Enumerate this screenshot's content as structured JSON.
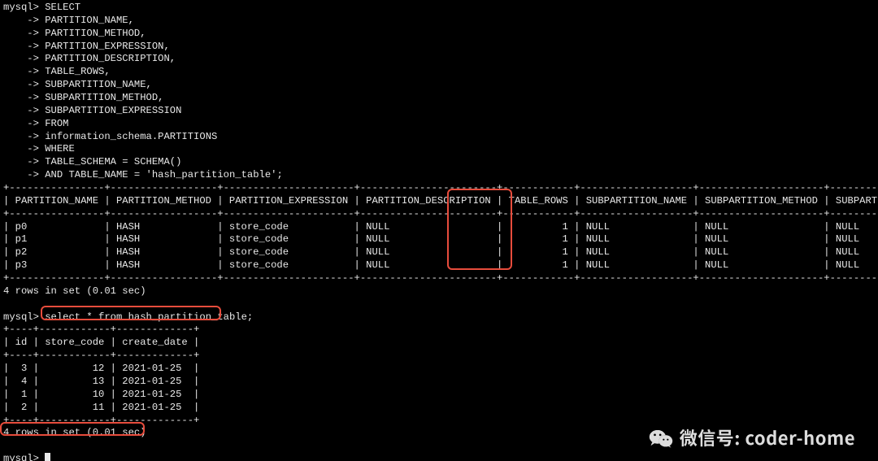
{
  "prompt_main": "mysql>",
  "prompt_cont": "    ->",
  "query1": {
    "lines": [
      "SELECT",
      "PARTITION_NAME,",
      "PARTITION_METHOD,",
      "PARTITION_EXPRESSION,",
      "PARTITION_DESCRIPTION,",
      "TABLE_ROWS,",
      "SUBPARTITION_NAME,",
      "SUBPARTITION_METHOD,",
      "SUBPARTITION_EXPRESSION",
      "FROM",
      "information_schema.PARTITIONS",
      "WHERE",
      "TABLE_SCHEMA = SCHEMA()",
      "AND TABLE_NAME = 'hash_partition_table';"
    ]
  },
  "table1": {
    "sep": "+----------------+------------------+----------------------+-----------------------+------------+-------------------+---------------------+-------------------------+",
    "header": "| PARTITION_NAME | PARTITION_METHOD | PARTITION_EXPRESSION | PARTITION_DESCRIPTION | TABLE_ROWS | SUBPARTITION_NAME | SUBPARTITION_METHOD | SUBPARTITION_EXPRESSION |",
    "rows": [
      "| p0             | HASH             | store_code           | NULL                  |          1 | NULL              | NULL                | NULL                    |",
      "| p1             | HASH             | store_code           | NULL                  |          1 | NULL              | NULL                | NULL                    |",
      "| p2             | HASH             | store_code           | NULL                  |          1 | NULL              | NULL                | NULL                    |",
      "| p3             | HASH             | store_code           | NULL                  |          1 | NULL              | NULL                | NULL                    |"
    ],
    "footer": "4 rows in set (0.01 sec)"
  },
  "query2": "select * from hash_partition_table;",
  "table2": {
    "sep": "+----+------------+-------------+",
    "header": "| id | store_code | create_date |",
    "rows": [
      "|  3 |         12 | 2021-01-25  |",
      "|  4 |         13 | 2021-01-25  |",
      "|  1 |         10 | 2021-01-25  |",
      "|  2 |         11 | 2021-01-25  |"
    ],
    "footer": "4 rows in set (0.01 sec)"
  },
  "watermark": {
    "label_prefix": "微信号:",
    "label_value": "coder-home"
  },
  "chart_data": {
    "type": "table",
    "tables": [
      {
        "name": "information_schema.PARTITIONS",
        "columns": [
          "PARTITION_NAME",
          "PARTITION_METHOD",
          "PARTITION_EXPRESSION",
          "PARTITION_DESCRIPTION",
          "TABLE_ROWS",
          "SUBPARTITION_NAME",
          "SUBPARTITION_METHOD",
          "SUBPARTITION_EXPRESSION"
        ],
        "rows": [
          [
            "p0",
            "HASH",
            "store_code",
            "NULL",
            1,
            "NULL",
            "NULL",
            "NULL"
          ],
          [
            "p1",
            "HASH",
            "store_code",
            "NULL",
            1,
            "NULL",
            "NULL",
            "NULL"
          ],
          [
            "p2",
            "HASH",
            "store_code",
            "NULL",
            1,
            "NULL",
            "NULL",
            "NULL"
          ],
          [
            "p3",
            "HASH",
            "store_code",
            "NULL",
            1,
            "NULL",
            "NULL",
            "NULL"
          ]
        ],
        "footer": "4 rows in set (0.01 sec)"
      },
      {
        "name": "hash_partition_table",
        "columns": [
          "id",
          "store_code",
          "create_date"
        ],
        "rows": [
          [
            3,
            12,
            "2021-01-25"
          ],
          [
            4,
            13,
            "2021-01-25"
          ],
          [
            1,
            10,
            "2021-01-25"
          ],
          [
            2,
            11,
            "2021-01-25"
          ]
        ],
        "footer": "4 rows in set (0.01 sec)"
      }
    ]
  }
}
